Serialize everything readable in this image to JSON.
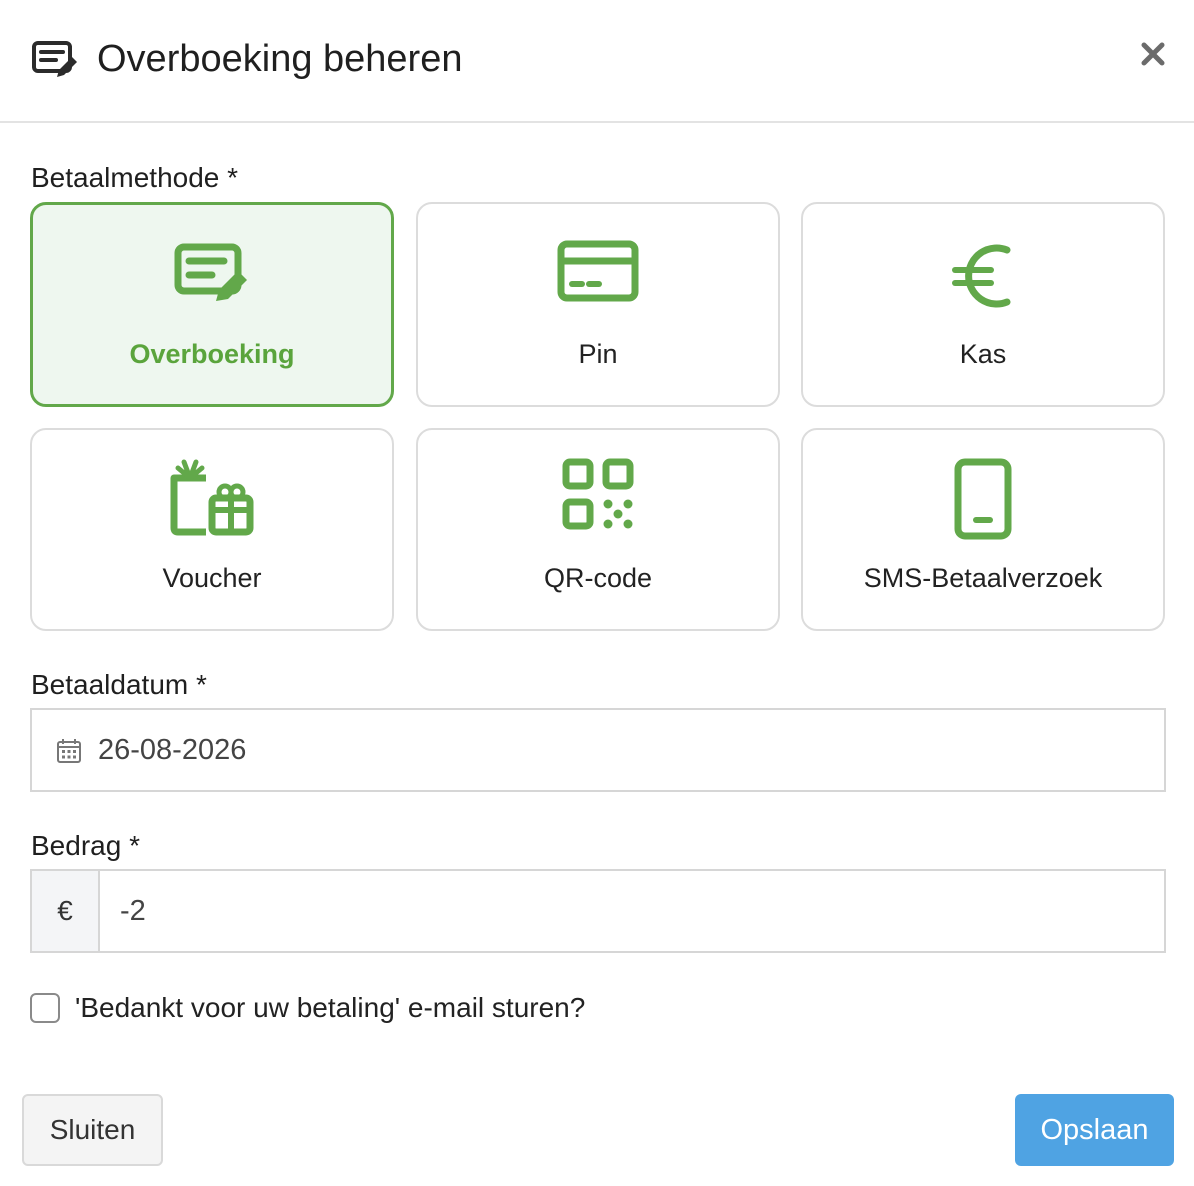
{
  "header": {
    "title": "Overboeking beheren",
    "icon": "edit-note-icon",
    "close_icon": "close-icon"
  },
  "payment_method": {
    "label": "Betaalmethode *",
    "selected": "Overboeking",
    "accent_color": "#62a84a",
    "options": [
      {
        "label": "Overboeking",
        "icon": "edit-note-icon"
      },
      {
        "label": "Pin",
        "icon": "credit-card-icon"
      },
      {
        "label": "Kas",
        "icon": "euro-icon"
      },
      {
        "label": "Voucher",
        "icon": "voucher-gift-icon"
      },
      {
        "label": "QR-code",
        "icon": "qr-code-icon"
      },
      {
        "label": "SMS-Betaalverzoek",
        "icon": "mobile-phone-icon"
      }
    ]
  },
  "payment_date": {
    "label": "Betaaldatum *",
    "value": "26-08-2026",
    "icon": "calendar-icon"
  },
  "amount": {
    "label": "Bedrag *",
    "prefix": "€",
    "value": "-2"
  },
  "thank_you_email": {
    "label": "'Bedankt voor uw betaling' e-mail sturen?",
    "checked": false
  },
  "footer": {
    "close_label": "Sluiten",
    "save_label": "Opslaan",
    "save_color": "#4fa3e3"
  }
}
